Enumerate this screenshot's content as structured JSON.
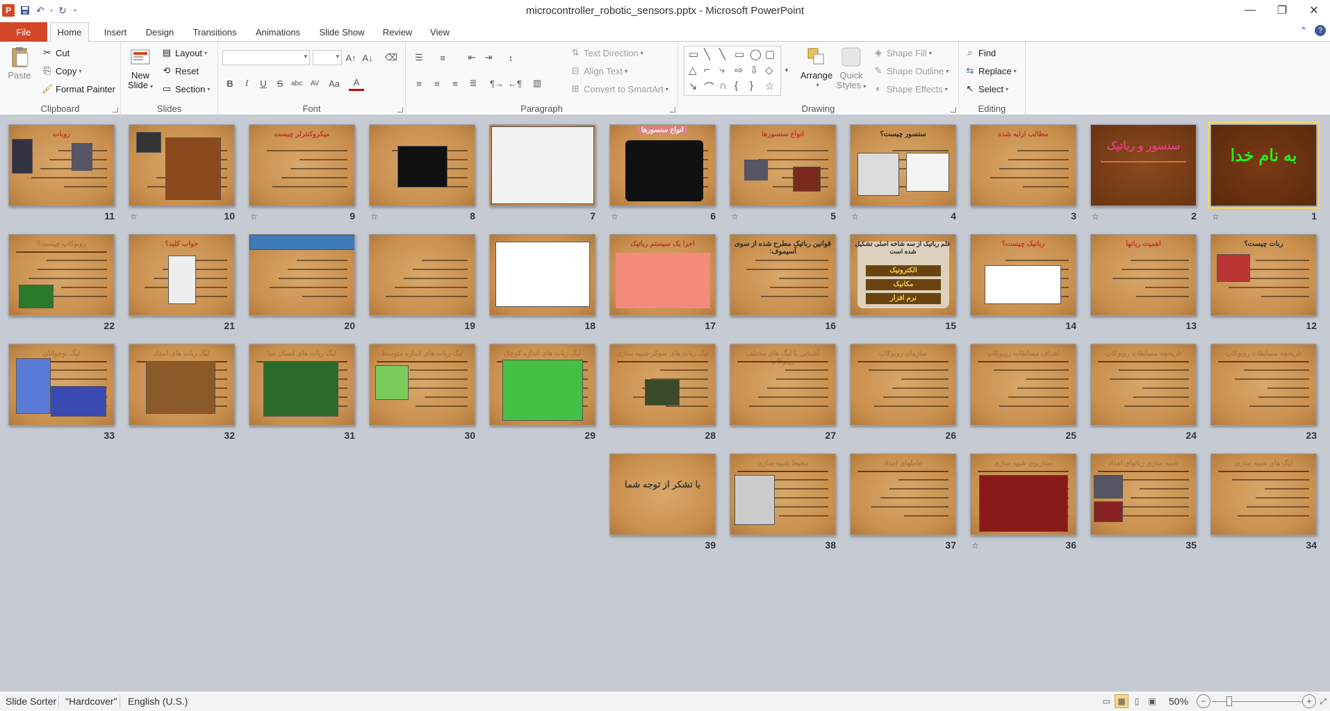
{
  "window": {
    "title": "microcontroller_robotic_sensors.pptx - Microsoft PowerPoint",
    "app_letter": "P"
  },
  "qat": {
    "save_icon": "save-icon",
    "undo_icon": "undo-icon",
    "repeat_icon": "repeat-icon"
  },
  "tabs": {
    "file": "File",
    "home": "Home",
    "insert": "Insert",
    "design": "Design",
    "transitions": "Transitions",
    "animations": "Animations",
    "slideshow": "Slide Show",
    "review": "Review",
    "view": "View"
  },
  "ribbon": {
    "clipboard": {
      "label": "Clipboard",
      "paste": "Paste",
      "cut": "Cut",
      "copy": "Copy",
      "format_painter": "Format Painter"
    },
    "slides": {
      "label": "Slides",
      "new_slide_1": "New",
      "new_slide_2": "Slide",
      "layout": "Layout",
      "reset": "Reset",
      "section": "Section"
    },
    "font": {
      "label": "Font",
      "bold": "B",
      "italic": "I",
      "underline": "U",
      "strike": "S",
      "char_spacing": "abc",
      "change_case": "Aa",
      "font_color": "A"
    },
    "paragraph": {
      "label": "Paragraph",
      "text_direction": "Text Direction",
      "align_text": "Align Text",
      "convert_smartart": "Convert to SmartArt"
    },
    "drawing": {
      "label": "Drawing",
      "arrange": "Arrange",
      "quick_styles_1": "Quick",
      "quick_styles_2": "Styles",
      "shape_fill": "Shape Fill",
      "shape_outline": "Shape Outline",
      "shape_effects": "Shape Effects"
    },
    "editing": {
      "label": "Editing",
      "find": "Find",
      "replace": "Replace",
      "select": "Select"
    }
  },
  "slides": [
    {
      "num": "1",
      "title": "به نام خدا"
    },
    {
      "num": "2",
      "title": "سنسور و رباتیک"
    },
    {
      "num": "3",
      "title": "مطالب ارایه شده"
    },
    {
      "num": "4",
      "title": "سنسور چیست؟"
    },
    {
      "num": "5",
      "title": "انواع سنسورها"
    },
    {
      "num": "6",
      "title": "انواع سنسورها"
    },
    {
      "num": "7",
      "title": ""
    },
    {
      "num": "8",
      "title": ""
    },
    {
      "num": "9",
      "title": "میکروکنترلر چیست"
    },
    {
      "num": "10",
      "title": ""
    },
    {
      "num": "11",
      "title": "روبات"
    },
    {
      "num": "12",
      "title": "ربات چیست؟"
    },
    {
      "num": "13",
      "title": "اهمیت رباتها"
    },
    {
      "num": "14",
      "title": "رباتیک چیست؟"
    },
    {
      "num": "15",
      "title": "علم رباتیک از سه شاخه اصلی تشکیل شده است",
      "box1": "الکترونیک",
      "box2": "مکانیک",
      "box3": "نرم افزار"
    },
    {
      "num": "16",
      "title": "قوانین رباتیک مطرح شده از سوی آسیموف:"
    },
    {
      "num": "17",
      "title": "اجزا یک سیستم رباتیک"
    },
    {
      "num": "18",
      "title": ""
    },
    {
      "num": "19",
      "title": ""
    },
    {
      "num": "20",
      "title": ""
    },
    {
      "num": "21",
      "title": "جواب کلید؟"
    },
    {
      "num": "22",
      "title": "روبوکاپ چیست؟"
    },
    {
      "num": "23",
      "title": "تاریخچه مسابقات روبوکاپ"
    },
    {
      "num": "24",
      "title": "تاریخچه مسابقات روبوکاپ"
    },
    {
      "num": "25",
      "title": "اهداف مسابقات روبوکاپ"
    },
    {
      "num": "26",
      "title": "سازمان روبوکاپ"
    },
    {
      "num": "27",
      "title": "آشنایی با لیگ های مختلف روبوکاپ"
    },
    {
      "num": "28",
      "title": "لیگ ربات های سوکر شبیه سازی"
    },
    {
      "num": "29",
      "title": "لیگ ربات های اندازه کوچک"
    },
    {
      "num": "30",
      "title": "لیگ ربات های اندازه متوسط"
    },
    {
      "num": "31",
      "title": "لیگ ربات های انسان نما"
    },
    {
      "num": "32",
      "title": "لیگ ربات های امداد"
    },
    {
      "num": "33",
      "title": "لیگ نوجوانان"
    },
    {
      "num": "34",
      "title": "لیگ های شبیه سازی"
    },
    {
      "num": "35",
      "title": "شبیه سازی رباتهای امداد"
    },
    {
      "num": "36",
      "title": "سناریوی شبیه سازی"
    },
    {
      "num": "37",
      "title": "عاملهای امداد"
    },
    {
      "num": "38",
      "title": "محیط شبیه سازی"
    },
    {
      "num": "39",
      "title": "با تشکر از توجه شما"
    }
  ],
  "status": {
    "view_mode": "Slide Sorter",
    "theme": "\"Hardcover\"",
    "language": "English (U.S.)",
    "zoom": "50%"
  }
}
